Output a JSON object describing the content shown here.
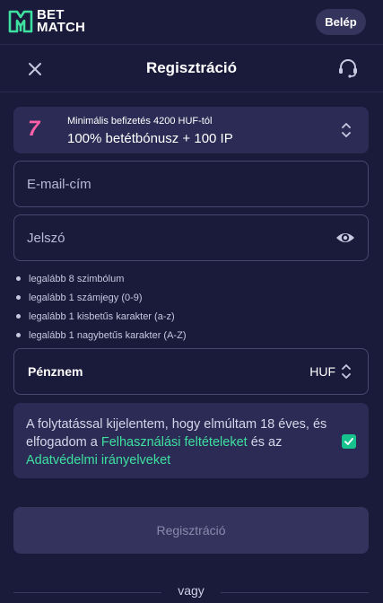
{
  "brand": {
    "line1": "BET",
    "line2": "MATCH",
    "accent": "#3ee0a0"
  },
  "topbar": {
    "login_label": "Belép"
  },
  "header": {
    "title": "Regisztráció",
    "close_icon": "close-icon",
    "support_icon": "headset-icon"
  },
  "bonus": {
    "icon": "lucky-seven-icon",
    "icon_glyph": "7",
    "subtitle": "Minimális befizetés 4200 HUF-tól",
    "title": "100% betétbónusz + 100 IP"
  },
  "form": {
    "email_placeholder": "E-mail-cím",
    "password_placeholder": "Jelszó",
    "password_rules": [
      "legalább 8 szimbólum",
      "legalább 1 számjegy (0-9)",
      "legalább 1 kisbetűs karakter (a-z)",
      "legalább 1 nagybetűs karakter (A-Z)"
    ],
    "currency_label": "Pénznem",
    "currency_value": "HUF",
    "terms": {
      "text_before": "A folytatással kijelentem, hogy elmúltam 18 éves, és elfogadom a ",
      "link1": "Felhasználási feltételeket",
      "text_middle": " és az ",
      "link2": "Adatvédelmi irányelveket",
      "checked": true
    },
    "submit_label": "Regisztráció",
    "divider_label": "vagy"
  },
  "colors": {
    "background": "#1a1a3a",
    "card": "#2b2b55",
    "accent": "#3ee0a0",
    "checkbox": "#17c38d",
    "disabled_button": "#33335e"
  }
}
